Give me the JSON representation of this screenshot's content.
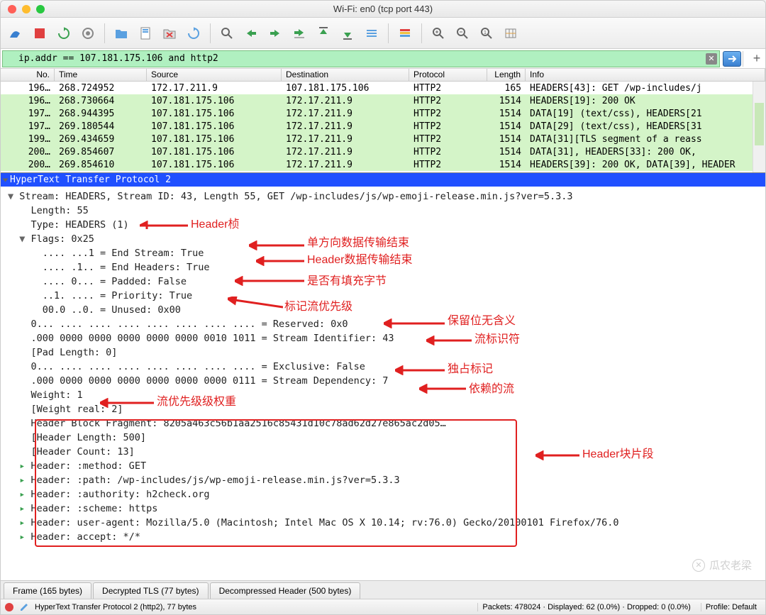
{
  "title": "Wi-Fi: en0 (tcp port 443)",
  "filter": "ip.addr == 107.181.175.106 and http2",
  "columns": {
    "no": "No.",
    "time": "Time",
    "source": "Source",
    "destination": "Destination",
    "protocol": "Protocol",
    "length": "Length",
    "info": "Info"
  },
  "packets": [
    {
      "no": "196…",
      "time": "268.724952",
      "src": "172.17.211.9",
      "dst": "107.181.175.106",
      "proto": "HTTP2",
      "len": "165",
      "info": "HEADERS[43]: GET /wp-includes/j",
      "white": true
    },
    {
      "no": "196…",
      "time": "268.730664",
      "src": "107.181.175.106",
      "dst": "172.17.211.9",
      "proto": "HTTP2",
      "len": "1514",
      "info": "HEADERS[19]: 200 OK"
    },
    {
      "no": "197…",
      "time": "268.944395",
      "src": "107.181.175.106",
      "dst": "172.17.211.9",
      "proto": "HTTP2",
      "len": "1514",
      "info": "DATA[19] (text/css), HEADERS[21"
    },
    {
      "no": "197…",
      "time": "269.180544",
      "src": "107.181.175.106",
      "dst": "172.17.211.9",
      "proto": "HTTP2",
      "len": "1514",
      "info": "DATA[29] (text/css), HEADERS[31"
    },
    {
      "no": "199…",
      "time": "269.434659",
      "src": "107.181.175.106",
      "dst": "172.17.211.9",
      "proto": "HTTP2",
      "len": "1514",
      "info": "DATA[31][TLS segment of a reass"
    },
    {
      "no": "200…",
      "time": "269.854607",
      "src": "107.181.175.106",
      "dst": "172.17.211.9",
      "proto": "HTTP2",
      "len": "1514",
      "info": "DATA[31], HEADERS[33]: 200 OK,"
    },
    {
      "no": "200…",
      "time": "269.854610",
      "src": "107.181.175.106",
      "dst": "172.17.211.9",
      "proto": "HTTP2",
      "len": "1514",
      "info": "HEADERS[39]: 200 OK, DATA[39], HEADER"
    }
  ],
  "details": {
    "title": "HyperText Transfer Protocol 2",
    "lines": [
      "Stream: HEADERS, Stream ID: 43, Length 55, GET /wp-includes/js/wp-emoji-release.min.js?ver=5.3.3",
      "  Length: 55",
      "  Type: HEADERS (1)",
      "  Flags: 0x25",
      "    .... ...1 = End Stream: True",
      "    .... .1.. = End Headers: True",
      "    .... 0... = Padded: False",
      "    ..1. .... = Priority: True",
      "    00.0 ..0. = Unused: 0x00",
      "  0... .... .... .... .... .... .... .... = Reserved: 0x0",
      "  .000 0000 0000 0000 0000 0000 0010 1011 = Stream Identifier: 43",
      "  [Pad Length: 0]",
      "  0... .... .... .... .... .... .... .... = Exclusive: False",
      "  .000 0000 0000 0000 0000 0000 0000 0111 = Stream Dependency: 7",
      "  Weight: 1",
      "  [Weight real: 2]",
      "  Header Block Fragment: 8205a463c56b1aa2516c85431d10c78ad62d27e865ac2d05…",
      "  [Header Length: 500]",
      "  [Header Count: 13]",
      "  Header: :method: GET",
      "  Header: :path: /wp-includes/js/wp-emoji-release.min.js?ver=5.3.3",
      "  Header: :authority: h2check.org",
      "  Header: :scheme: https",
      "  Header: user-agent: Mozilla/5.0 (Macintosh; Intel Mac OS X 10.14; rv:76.0) Gecko/20100101 Firefox/76.0",
      "  Header: accept: */*"
    ]
  },
  "annotations": {
    "header_frame": "Header桢",
    "end_stream": "单方向数据传输结束",
    "end_headers": "Header数据传输结束",
    "padded": "是否有填充字节",
    "priority": "标记流优先级",
    "reserved": "保留位无含义",
    "stream_id": "流标识符",
    "exclusive": "独占标记",
    "dependency": "依赖的流",
    "weight": "流优先级级权重",
    "block_fragment": "Header块片段"
  },
  "tabs": [
    "Frame (165 bytes)",
    "Decrypted TLS (77 bytes)",
    "Decompressed Header (500 bytes)"
  ],
  "status": {
    "proto": "HyperText Transfer Protocol 2 (http2), 77 bytes",
    "packets": "Packets: 478024 · Displayed: 62 (0.0%) · Dropped: 0 (0.0%)",
    "profile": "Profile: Default"
  },
  "watermark": "瓜农老梁"
}
